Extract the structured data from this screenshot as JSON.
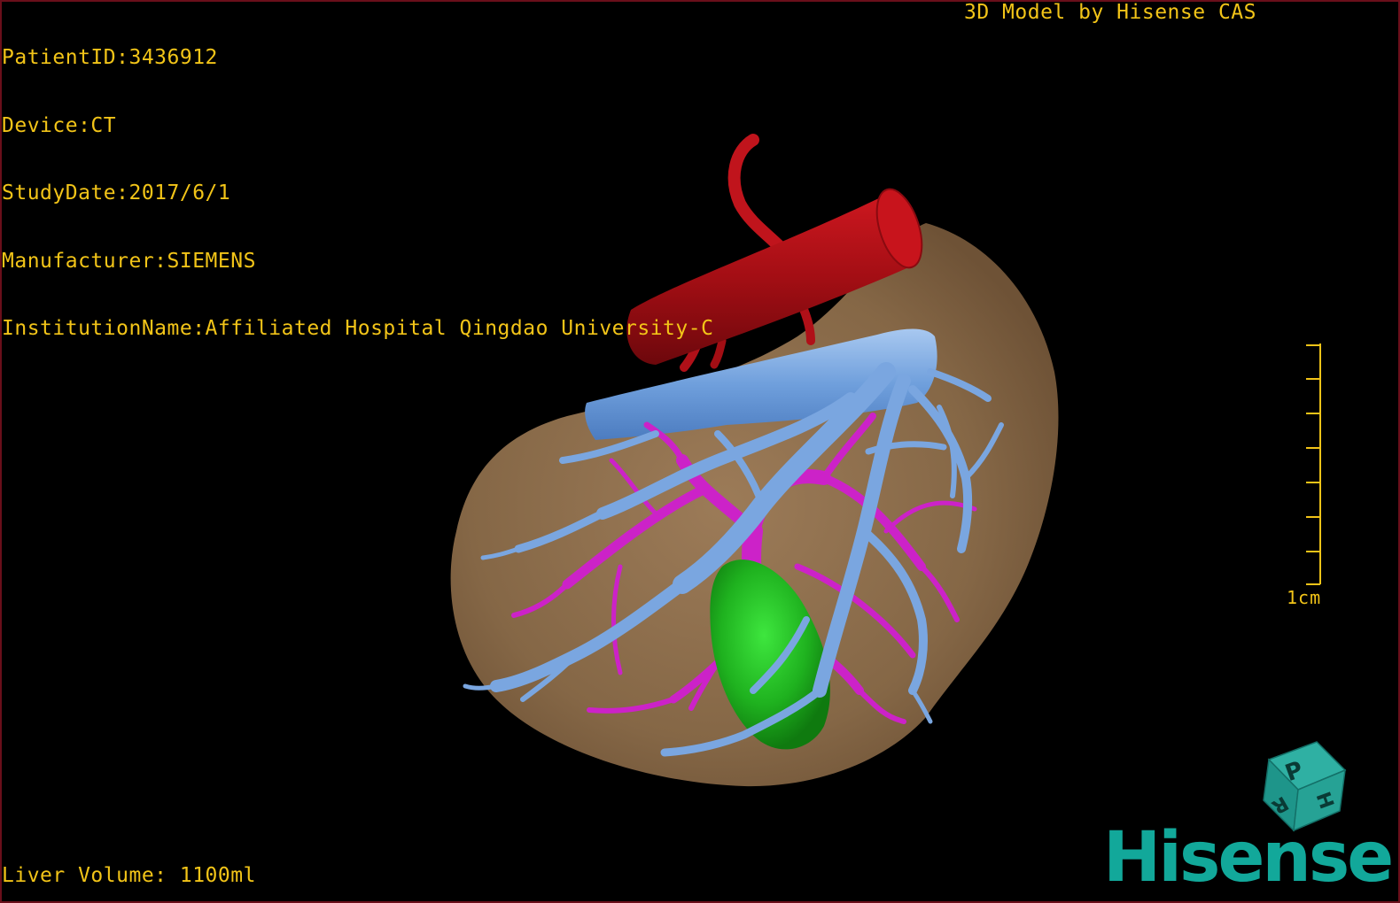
{
  "overlay": {
    "patient_id": "PatientID:3436912",
    "device": "Device:CT",
    "study_date": "StudyDate:2017/6/1",
    "manufacturer": "Manufacturer:SIEMENS",
    "institution": "InstitutionName:Affiliated Hospital Qingdao University-C",
    "credit": "3D Model by Hisense CAS",
    "liver_volume": "Liver Volume: 1100ml"
  },
  "scale_bar": {
    "label": "1cm"
  },
  "orientation_cube": {
    "faces": [
      "P",
      "H",
      "R"
    ]
  },
  "brand": {
    "logo_text": "Hisense"
  },
  "colors": {
    "overlay_text": "#f2c418",
    "liver": "#8b6c4c",
    "artery": "#b01018",
    "vein": "#6f9fdc",
    "portal": "#cc22c8",
    "gallbladder": "#1fb21f",
    "brand": "#12a89a",
    "frame": "#6a0f1a"
  }
}
